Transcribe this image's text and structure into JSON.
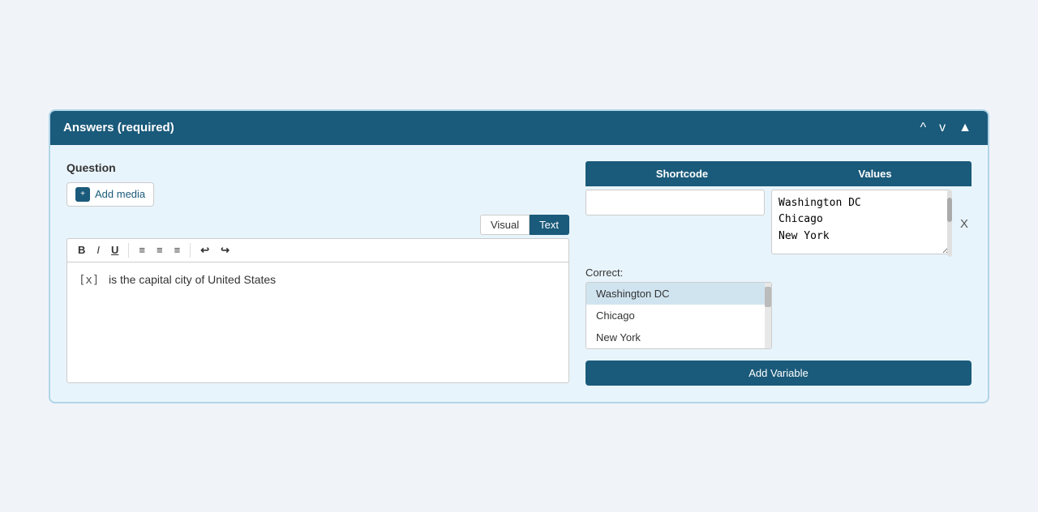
{
  "header": {
    "title": "Answers (required)",
    "collapse_up": "▲",
    "collapse_down": "▼",
    "chevron_up": "^"
  },
  "question": {
    "label": "Question",
    "add_media_label": "Add media",
    "tabs": [
      {
        "label": "Visual",
        "active": false
      },
      {
        "label": "Text",
        "active": true
      }
    ],
    "toolbar": {
      "bold": "B",
      "italic": "I",
      "underline": "U",
      "align_left": "≡",
      "align_center": "≡",
      "align_right": "≡",
      "undo": "↩",
      "redo": "↪"
    },
    "editor_text": "[x]  is the capital city of United States"
  },
  "table": {
    "col_shortcode": "Shortcode",
    "col_values": "Values",
    "shortcode_placeholder": "",
    "values_content": "Washington DC\nChicago\nNew York",
    "remove_btn": "X"
  },
  "correct": {
    "label": "Correct:",
    "options": [
      {
        "text": "Washington DC",
        "selected": true
      },
      {
        "text": "Chicago",
        "selected": false
      },
      {
        "text": "New York",
        "selected": false
      }
    ]
  },
  "add_variable": {
    "label": "Add Variable"
  }
}
